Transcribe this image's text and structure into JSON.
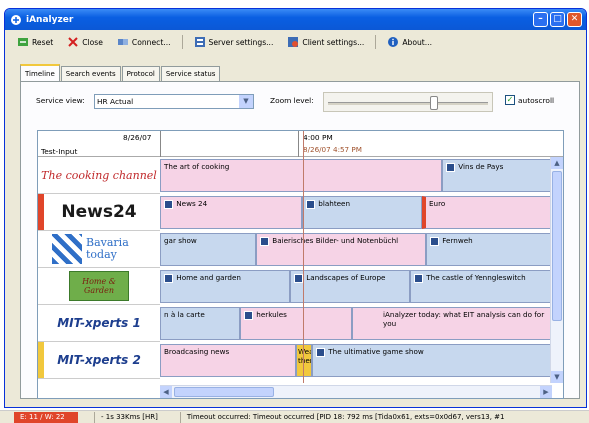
{
  "window": {
    "title": "iAnalyzer"
  },
  "toolbar": {
    "reset": "Reset",
    "close": "Close",
    "connect": "Connect...",
    "server_settings": "Server settings...",
    "client_settings": "Client settings...",
    "about": "About..."
  },
  "tabs": [
    "Timeline",
    "Search events",
    "Protocol",
    "Service status"
  ],
  "controls": {
    "service_view_label": "Service view:",
    "service_view_value": "HR Actual",
    "zoom_label": "Zoom level:",
    "zoom_level": 0.66,
    "autoscroll_label": "autoscroll",
    "autoscroll_checked": true
  },
  "timeline": {
    "date": "8/26/07",
    "time": "4:00 PM",
    "now": "8/26/07 4:57 PM",
    "row_header": "Test-Input",
    "channels": [
      {
        "name": "The cooking channel",
        "programs": [
          {
            "title": "The art of cooking",
            "color": "pink"
          },
          {
            "title": "Vins de Pays",
            "color": "blue"
          }
        ]
      },
      {
        "name": "News24",
        "programs": [
          {
            "title": "News 24",
            "color": "pink"
          },
          {
            "title": "blahteen",
            "color": "blue"
          },
          {
            "title": "Euro",
            "color": "pink"
          }
        ]
      },
      {
        "name": "Bavaria today",
        "programs": [
          {
            "title": "gar show",
            "color": "blue"
          },
          {
            "title": "Baierisches Bilder- und Notenbüchl",
            "color": "pink"
          },
          {
            "title": "Fernweh",
            "color": "blue"
          }
        ]
      },
      {
        "name": "Home & Garden",
        "programs": [
          {
            "title": "Home and garden",
            "color": "blue"
          },
          {
            "title": "Landscapes of Europe",
            "color": "blue"
          },
          {
            "title": "The castle of Yenngleswitch",
            "color": "blue"
          }
        ]
      },
      {
        "name": "MIT-xperts 1",
        "programs": [
          {
            "title": "n à la carte",
            "color": "blue"
          },
          {
            "title": "herkules",
            "color": "pink"
          },
          {
            "title": "iAnalyzer today: what EIT analysis can do for you",
            "color": "pink"
          }
        ]
      },
      {
        "name": "MIT-xperts 2",
        "programs": [
          {
            "title": "Broadcasing news",
            "color": "pink"
          },
          {
            "title": "Wea ther",
            "color": "pink"
          },
          {
            "title": "The ultimative game show",
            "color": "blue"
          }
        ]
      }
    ]
  },
  "status": {
    "error_count": "E: 11 / W: 22",
    "timing": "- 1s 33Kms [HR]",
    "message": "Timeout occurred: Timeout occurred [PID 18: 792 ms [Tida0x61, exts=0x0d67, vers13, #1"
  },
  "colors": {
    "accent": "#0a5fe2",
    "pink": "#f6d3e6",
    "blue": "#c7d8ee",
    "now_line": "#c07a6a",
    "error": "#e0452a"
  }
}
